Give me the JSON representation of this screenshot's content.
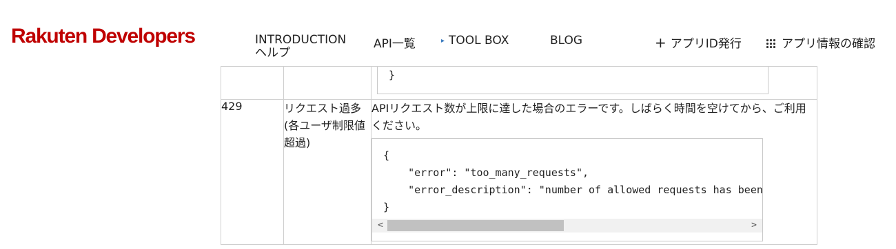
{
  "header": {
    "logo": "Rakuten Developers",
    "nav": {
      "introduction": "INTRODUCTION",
      "help": "ヘルプ",
      "api_list": "API一覧",
      "toolbox_marker": "▸",
      "toolbox": "TOOL BOX",
      "blog": "BLOG",
      "app_id_plus": "+",
      "app_id": "アプリID発行",
      "app_info": "アプリ情報の確認"
    }
  },
  "table": {
    "prev_row": {
      "code_tail": "}"
    },
    "row": {
      "code": "429",
      "name": "リクエスト過多 (各ユーザ制限値超過)",
      "description": "APIリクエスト数が上限に達した場合のエラーです。しばらく時間を空けてから、ご利用ください。",
      "code_sample": "{\n    \"error\": \"too_many_requests\",\n    \"error_description\": \"number of allowed requests has been exceeded for this API. please try again soon.\"\n}",
      "scroll_left": "<",
      "scroll_right": ">",
      "scroll_position": 0
    }
  }
}
